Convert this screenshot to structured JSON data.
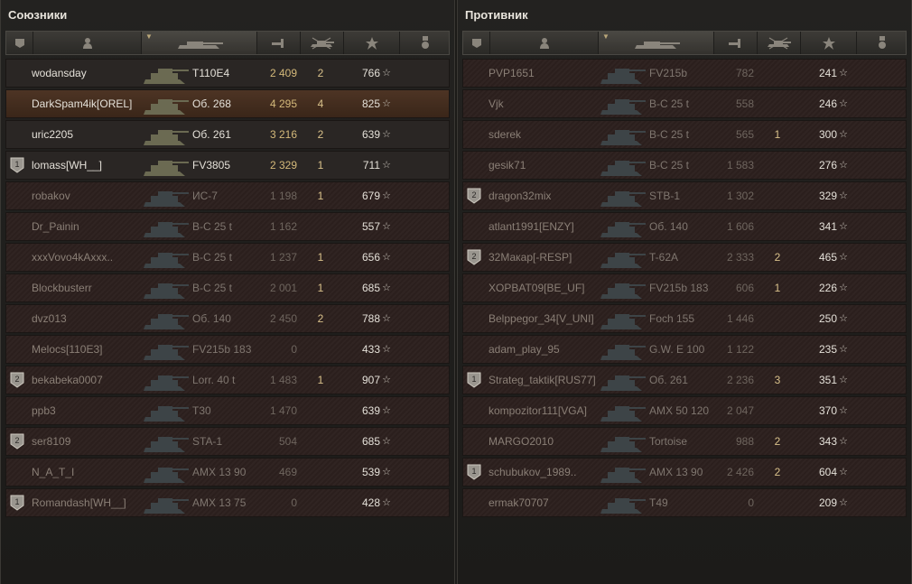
{
  "allies": {
    "title": "Союзники",
    "rows": [
      {
        "badge": "",
        "name": "wodansday",
        "vehicle": "T110E4",
        "damage": "2 409",
        "frags": "2",
        "xp": "766",
        "state": "alive"
      },
      {
        "badge": "",
        "name": "DarkSpam4ik[OREL]",
        "vehicle": "Об. 268",
        "damage": "4 295",
        "frags": "4",
        "xp": "825",
        "state": "player"
      },
      {
        "badge": "",
        "name": "uric2205",
        "vehicle": "Об. 261",
        "damage": "3 216",
        "frags": "2",
        "xp": "639",
        "state": "alive"
      },
      {
        "badge": "1",
        "name": "lomass[WH__]",
        "vehicle": "FV3805",
        "damage": "2 329",
        "frags": "1",
        "xp": "711",
        "state": "alive"
      },
      {
        "badge": "",
        "name": "robakov",
        "vehicle": "ИС-7",
        "damage": "1 198",
        "frags": "1",
        "xp": "679",
        "state": "dead"
      },
      {
        "badge": "",
        "name": "Dr_Painin",
        "vehicle": "B-C 25 t",
        "damage": "1 162",
        "frags": "",
        "xp": "557",
        "state": "dead"
      },
      {
        "badge": "",
        "name": "xxxVovo4kAxxx..",
        "vehicle": "B-C 25 t",
        "damage": "1 237",
        "frags": "1",
        "xp": "656",
        "state": "dead"
      },
      {
        "badge": "",
        "name": "Blockbusterr",
        "vehicle": "B-C 25 t",
        "damage": "2 001",
        "frags": "1",
        "xp": "685",
        "state": "dead"
      },
      {
        "badge": "",
        "name": "dvz013",
        "vehicle": "Об. 140",
        "damage": "2 450",
        "frags": "2",
        "xp": "788",
        "state": "dead"
      },
      {
        "badge": "",
        "name": "Melocs[110E3]",
        "vehicle": "FV215b 183",
        "damage": "0",
        "frags": "",
        "xp": "433",
        "state": "dead"
      },
      {
        "badge": "2",
        "name": "bekabeka0007",
        "vehicle": "Lorr. 40 t",
        "damage": "1 483",
        "frags": "1",
        "xp": "907",
        "state": "dead"
      },
      {
        "badge": "",
        "name": "ppb3",
        "vehicle": "T30",
        "damage": "1 470",
        "frags": "",
        "xp": "639",
        "state": "dead"
      },
      {
        "badge": "2",
        "name": "ser8109",
        "vehicle": "STA-1",
        "damage": "504",
        "frags": "",
        "xp": "685",
        "state": "dead"
      },
      {
        "badge": "",
        "name": "N_A_T_I",
        "vehicle": "AMX 13 90",
        "damage": "469",
        "frags": "",
        "xp": "539",
        "state": "dead"
      },
      {
        "badge": "1",
        "name": "Romandash[WH__]",
        "vehicle": "AMX 13 75",
        "damage": "0",
        "frags": "",
        "xp": "428",
        "state": "dead"
      }
    ]
  },
  "enemies": {
    "title": "Противник",
    "rows": [
      {
        "badge": "",
        "name": "PVP1651",
        "vehicle": "FV215b",
        "damage": "782",
        "frags": "",
        "xp": "241",
        "state": "dead"
      },
      {
        "badge": "",
        "name": "Vjk",
        "vehicle": "B-C 25 t",
        "damage": "558",
        "frags": "",
        "xp": "246",
        "state": "dead"
      },
      {
        "badge": "",
        "name": "sderek",
        "vehicle": "B-C 25 t",
        "damage": "565",
        "frags": "1",
        "xp": "300",
        "state": "dead"
      },
      {
        "badge": "",
        "name": "gesik71",
        "vehicle": "B-C 25 t",
        "damage": "1 583",
        "frags": "",
        "xp": "276",
        "state": "dead"
      },
      {
        "badge": "2",
        "name": "dragon32mix",
        "vehicle": "STB-1",
        "damage": "1 302",
        "frags": "",
        "xp": "329",
        "state": "dead"
      },
      {
        "badge": "",
        "name": "atlant1991[ENZY]",
        "vehicle": "Об. 140",
        "damage": "1 606",
        "frags": "",
        "xp": "341",
        "state": "dead"
      },
      {
        "badge": "2",
        "name": "32Макар[-RESP]",
        "vehicle": "T-62A",
        "damage": "2 333",
        "frags": "2",
        "xp": "465",
        "state": "dead"
      },
      {
        "badge": "",
        "name": "XOPBAT09[BE_UF]",
        "vehicle": "FV215b 183",
        "damage": "606",
        "frags": "1",
        "xp": "226",
        "state": "dead"
      },
      {
        "badge": "",
        "name": "Belppegor_34[V_UNI]",
        "vehicle": "Foch 155",
        "damage": "1 446",
        "frags": "",
        "xp": "250",
        "state": "dead"
      },
      {
        "badge": "",
        "name": "adam_play_95",
        "vehicle": "G.W. E 100",
        "damage": "1 122",
        "frags": "",
        "xp": "235",
        "state": "dead"
      },
      {
        "badge": "1",
        "name": "Strateg_taktik[RUS77]",
        "vehicle": "Об. 261",
        "damage": "2 236",
        "frags": "3",
        "xp": "351",
        "state": "dead"
      },
      {
        "badge": "",
        "name": "kompozitor111[VGA]",
        "vehicle": "AMX 50 120",
        "damage": "2 047",
        "frags": "",
        "xp": "370",
        "state": "dead"
      },
      {
        "badge": "",
        "name": "MARGO2010",
        "vehicle": "Tortoise",
        "damage": "988",
        "frags": "2",
        "xp": "343",
        "state": "dead"
      },
      {
        "badge": "1",
        "name": "schubukov_1989..",
        "vehicle": "AMX 13 90",
        "damage": "2 426",
        "frags": "2",
        "xp": "604",
        "state": "dead"
      },
      {
        "badge": "",
        "name": "ermak70707",
        "vehicle": "T49",
        "damage": "0",
        "frags": "",
        "xp": "209",
        "state": "dead"
      }
    ]
  },
  "columns": [
    "rank-icon",
    "player-icon",
    "tank-icon",
    "damage-icon",
    "frags-icon",
    "xp-star-icon",
    "medal-icon"
  ],
  "star_glyph": "☆"
}
